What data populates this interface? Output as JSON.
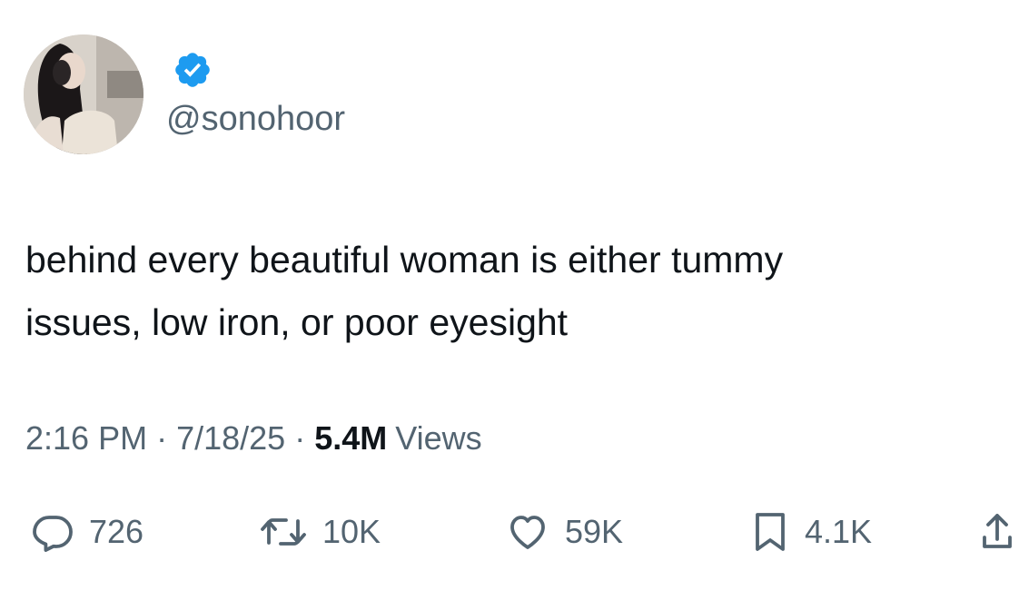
{
  "tweet": {
    "handle": "@sonohoor",
    "text_lines": [
      "behind every beautiful woman is either tummy",
      "issues, low iron, or poor eyesight"
    ],
    "time": "2:16 PM",
    "date": "7/18/25",
    "separator": "·",
    "views_count": "5.4M",
    "views_label": "Views"
  },
  "actions": {
    "reply": {
      "count": "726",
      "icon": "reply-icon"
    },
    "retweet": {
      "count": "10K",
      "icon": "retweet-icon"
    },
    "like": {
      "count": "59K",
      "icon": "heart-icon"
    },
    "bookmark": {
      "count": "4.1K",
      "icon": "bookmark-icon"
    },
    "share": {
      "icon": "share-icon"
    }
  },
  "colors": {
    "text": "#0f1419",
    "secondary": "#536471",
    "verified": "#1d9bf0"
  }
}
